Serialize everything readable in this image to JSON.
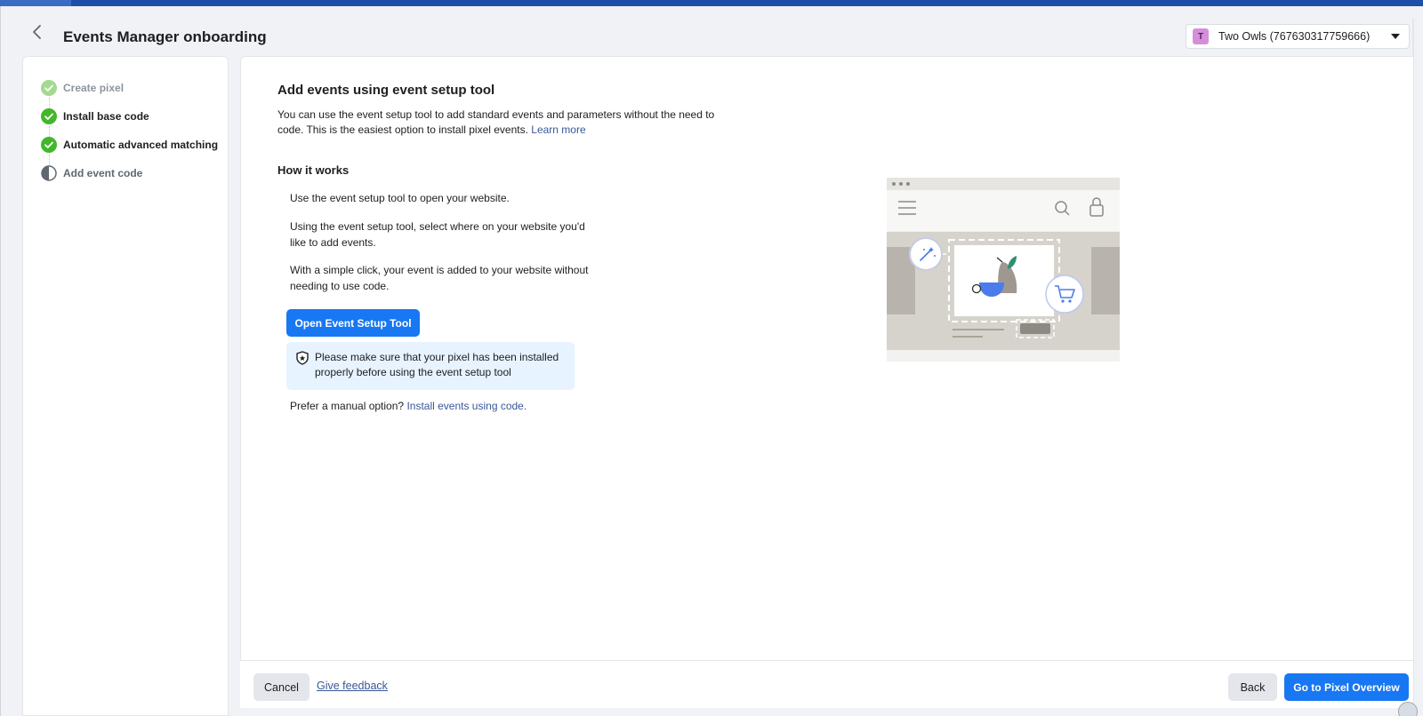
{
  "header": {
    "title": "Events Manager onboarding",
    "account": {
      "avatar_letter": "T",
      "name": "Two Owls (767630317759666)"
    }
  },
  "steps": [
    {
      "label": "Create pixel",
      "status": "done-dim"
    },
    {
      "label": "Install base code",
      "status": "done"
    },
    {
      "label": "Automatic advanced matching",
      "status": "done"
    },
    {
      "label": "Add event code",
      "status": "current"
    }
  ],
  "main": {
    "heading": "Add events using event setup tool",
    "intro": "You can use the event setup tool to add standard events and parameters without the need to code. This is the easiest option to install pixel events.",
    "learn_more": "Learn more",
    "how_heading": "How it works",
    "how_items": [
      "Use the event setup tool to open your website.",
      "Using the event setup tool, select where on your website you'd like to add events.",
      "With a simple click, your event is added to your website without needing to use code."
    ],
    "open_tool_button": "Open Event Setup Tool",
    "notice": "Please make sure that your pixel has been installed properly before using the event setup tool",
    "manual_prefix": "Prefer a manual option?",
    "manual_link": "Install events using code."
  },
  "footer": {
    "cancel": "Cancel",
    "feedback": "Give feedback",
    "back": "Back",
    "go": "Go to Pixel Overview"
  },
  "colors": {
    "primary": "#1877f2",
    "success": "#42b72a",
    "link": "#385898",
    "notice_bg": "#e7f3ff"
  }
}
